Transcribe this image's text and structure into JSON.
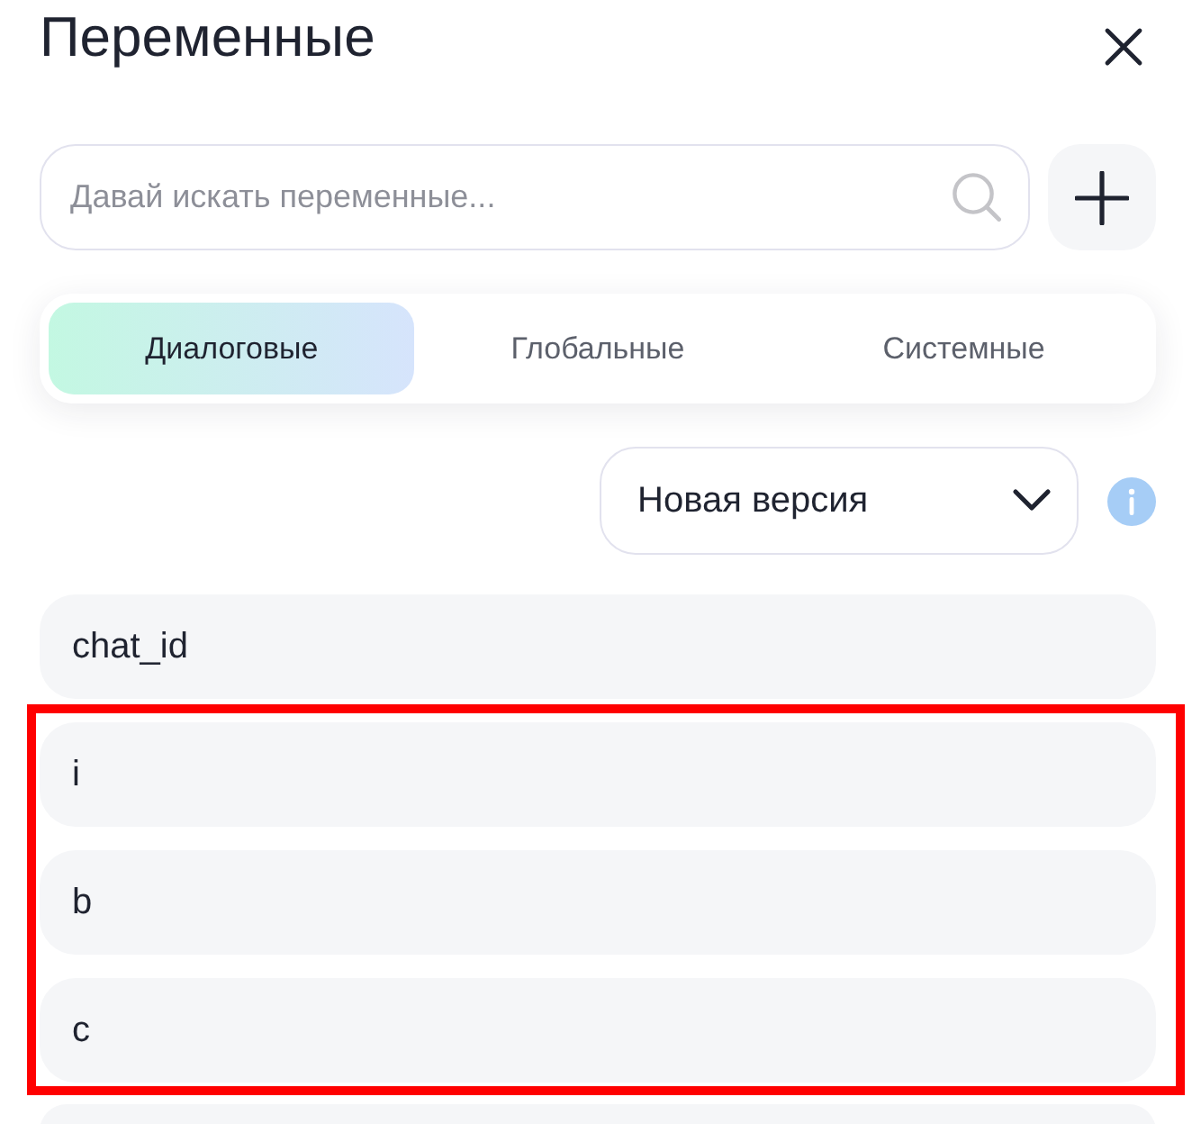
{
  "title": "Переменные",
  "search": {
    "placeholder": "Давай искать переменные..."
  },
  "tabs": [
    {
      "label": "Диалоговые",
      "selected": true
    },
    {
      "label": "Глобальные",
      "selected": false
    },
    {
      "label": "Системные",
      "selected": false
    }
  ],
  "version_select": {
    "value": "Новая версия"
  },
  "variables": [
    {
      "name": "chat_id"
    }
  ],
  "highlight_frame": {
    "variables": [
      {
        "name": "i"
      },
      {
        "name": "b"
      },
      {
        "name": "c"
      }
    ]
  }
}
